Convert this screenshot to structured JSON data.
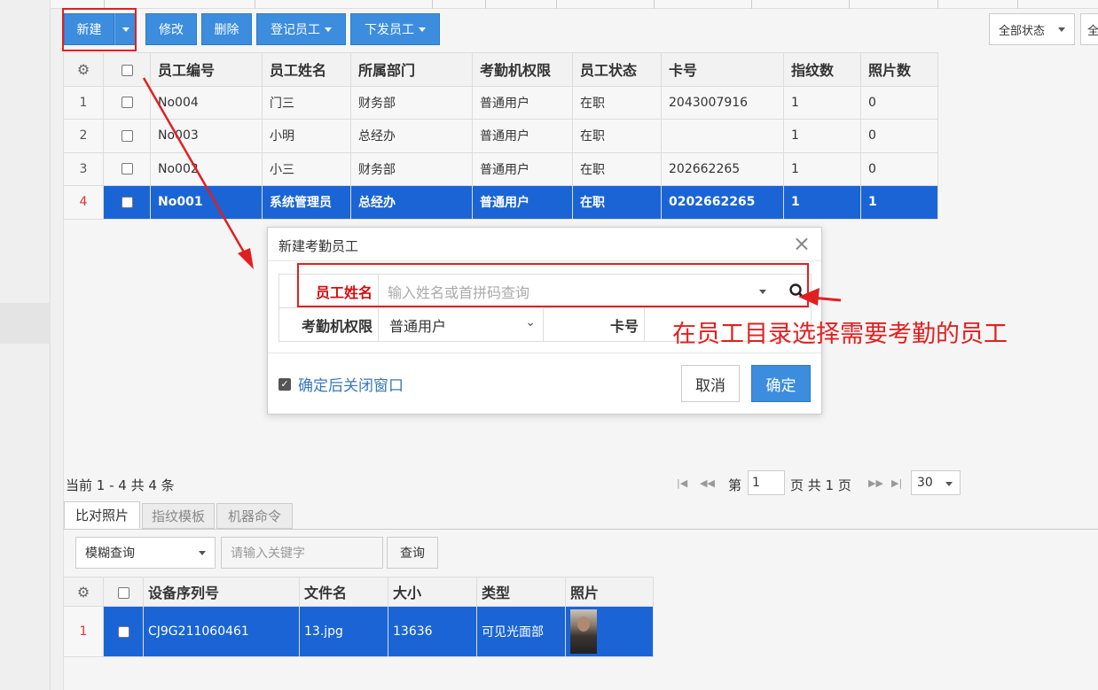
{
  "toolbar": {
    "new_label": "新建",
    "edit_label": "修改",
    "delete_label": "删除",
    "register_label": "登记员工",
    "issue_label": "下发员工",
    "status_filter": "全部状态",
    "cut_btn": "全"
  },
  "grid": {
    "columns": [
      "员工编号",
      "员工姓名",
      "所属部门",
      "考勤机权限",
      "员工状态",
      "卡号",
      "指纹数",
      "照片数"
    ],
    "rows": [
      {
        "n": "1",
        "id": "No004",
        "name": "门三",
        "dept": "财务部",
        "perm": "普通用户",
        "status": "在职",
        "card": "2043007916",
        "fp": "1",
        "photos": "0"
      },
      {
        "n": "2",
        "id": "No003",
        "name": "小明",
        "dept": "总经办",
        "perm": "普通用户",
        "status": "在职",
        "card": "",
        "fp": "1",
        "photos": "0"
      },
      {
        "n": "3",
        "id": "No002",
        "name": "小三",
        "dept": "财务部",
        "perm": "普通用户",
        "status": "在职",
        "card": "202662265",
        "fp": "1",
        "photos": "0"
      },
      {
        "n": "4",
        "id": "No001",
        "name": "系统管理员",
        "dept": "总经办",
        "perm": "普通用户",
        "status": "在职",
        "card": "0202662265",
        "fp": "1",
        "photos": "1"
      }
    ]
  },
  "pager": {
    "info": "当前 1 - 4 共 4 条",
    "page_prefix": "第",
    "page": "1",
    "page_suffix": "页 共 1 页",
    "page_size": "30"
  },
  "sub_tabs": [
    "比对照片",
    "指纹模板",
    "机器命令"
  ],
  "sub_search": {
    "mode": "模糊查询",
    "placeholder": "请输入关键字",
    "button": "查询"
  },
  "photo_grid": {
    "columns": [
      "设备序列号",
      "文件名",
      "大小",
      "类型",
      "照片"
    ],
    "rows": [
      {
        "n": "1",
        "serial": "CJ9G211060461",
        "file": "13.jpg",
        "size": "13636",
        "type": "可见光面部"
      }
    ]
  },
  "dialog": {
    "title": "新建考勤员工",
    "name_label": "员工姓名",
    "name_placeholder": "输入姓名或首拼码查询",
    "perm_label": "考勤机权限",
    "perm_value": "普通用户",
    "card_label": "卡号",
    "close_after": "确定后关闭窗口",
    "cancel": "取消",
    "ok": "确定"
  },
  "annotation": "在员工目录选择需要考勤的员工",
  "colors": {
    "primary": "#3c8dde",
    "selected_row": "#1a64d6",
    "annotation_red": "#e02020"
  }
}
